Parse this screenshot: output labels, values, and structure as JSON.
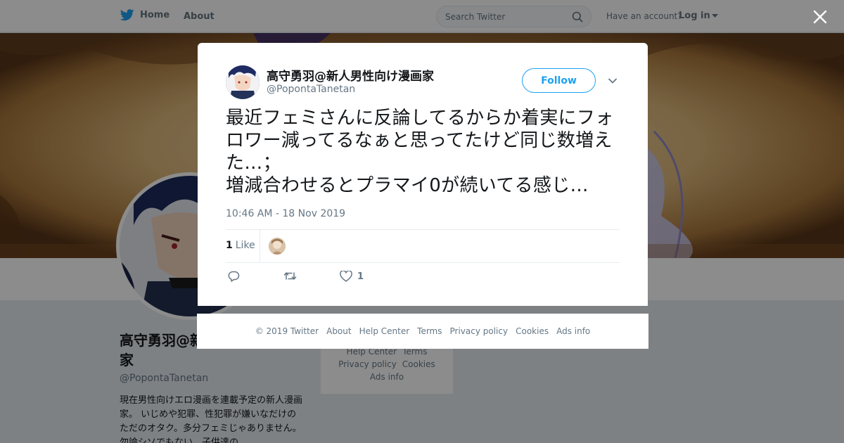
{
  "nav": {
    "home_label": "Home",
    "about_label": "About",
    "search_placeholder": "Search Twitter",
    "account_prompt": "Have an account?",
    "login_label": "Log in"
  },
  "profile": {
    "name": "高守勇羽@新人男性向け漫画家",
    "handle": "@PopontaTanetan",
    "bio": "現在男性向けエロ漫画を連載予定の新人漫画家。 いじめや犯罪、性犯罪が嫌いなだけのただのオタク。多分フェミじゃありません。勿論シソでもない。子供達の",
    "footer_links": [
      "Help Center",
      "Terms",
      "Privacy policy",
      "Cookies",
      "Ads info"
    ]
  },
  "tweet": {
    "author_name": "高守勇羽@新人男性向け漫画家",
    "author_handle": "@PopontaTanetan",
    "follow_label": "Follow",
    "text": "最近フェミさんに反論してるからか着実にフォロワー減ってるなぁと思ってたけど同じ数増えた…；\n増減合わせるとプラマイ0が続いてる感じ…",
    "timestamp": "10:46 AM - 18 Nov 2019",
    "like_count": "1",
    "like_word": "Like",
    "like_action_count": "1"
  },
  "footer": {
    "links": [
      "© 2019 Twitter",
      "About",
      "Help Center",
      "Terms",
      "Privacy policy",
      "Cookies",
      "Ads info"
    ]
  },
  "colors": {
    "brand": "#1da1f2",
    "secondary_text": "#657786",
    "primary_text": "#14171a",
    "overlay": "rgba(0,0,0,0.45)"
  },
  "icons": {
    "logo": "twitter-bird-icon",
    "search": "search-icon",
    "close": "close-icon",
    "caret": "chevron-down-icon",
    "reply": "reply-icon",
    "retweet": "retweet-icon",
    "like": "heart-icon"
  }
}
